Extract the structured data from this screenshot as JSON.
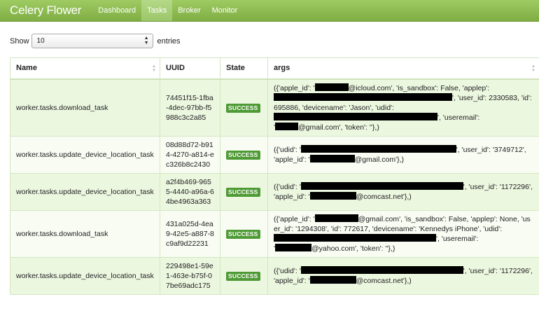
{
  "navbar": {
    "brand": "Celery Flower",
    "items": [
      {
        "label": "Dashboard",
        "active": false
      },
      {
        "label": "Tasks",
        "active": true
      },
      {
        "label": "Broker",
        "active": false
      },
      {
        "label": "Monitor",
        "active": false
      }
    ],
    "accent": "#8cba52"
  },
  "toolbar": {
    "show_label": "Show",
    "page_size": "10",
    "entries_label": "entries"
  },
  "table": {
    "columns": [
      "Name",
      "UUID",
      "State",
      "args"
    ],
    "rows": [
      {
        "name": "worker.tasks.download_task",
        "uuid": "74451f15-1fba-4dec-97bb-f5988c3c2a85",
        "state": "SUCCESS",
        "args": {
          "t1": "({'apple_id': '",
          "t2": "@icloud.com', 'is_sandbox': False, 'applep':",
          "t3": "', 'user_id': 2330583, 'id': 695886, 'devicename': 'Jason', 'udid':",
          "t4": "', 'useremail':",
          "t5": "'",
          "t6": "@gmail.com', 'token': ''},)"
        }
      },
      {
        "name": "worker.tasks.update_device_location_task",
        "uuid": "08d88d72-b914-4270-a814-ec326b8c2430",
        "state": "SUCCESS",
        "args": {
          "t1": "({'udid': '",
          "t2": "', 'user_id': '3749712', 'apple_id': '",
          "t3": "@gmail.com'},)"
        }
      },
      {
        "name": "worker.tasks.update_device_location_task",
        "uuid": "a2f4b469-9655-4440-a96a-64be4963a363",
        "state": "SUCCESS",
        "args": {
          "t1": "({'udid': '",
          "t2": "', 'user_id': '1172296', 'apple_id': '",
          "t3": "@comcast.net'},)"
        }
      },
      {
        "name": "worker.tasks.download_task",
        "uuid": "431a025d-4ea9-42e5-a887-8c9af9d22231",
        "state": "SUCCESS",
        "args": {
          "t1": "({'apple_id': '",
          "t2": "@gmail.com', 'is_sandbox': False, 'applep': None, 'user_id': '1294308', 'id': 772617, 'devicename': 'Kennedys iPhone', 'udid':",
          "t3": "', 'useremail':",
          "t4": "'",
          "t5": "@yahoo.com', 'token': ''},)"
        }
      },
      {
        "name": "worker.tasks.update_device_location_task",
        "uuid": "229498e1-59e1-463e-b75f-07be69adc175",
        "state": "SUCCESS",
        "args": {
          "t1": "({'udid': '",
          "t2": "', 'user_id': '1172296', 'apple_id': '",
          "t3": "@comcast.net'},)"
        }
      }
    ]
  },
  "colors": {
    "success_badge": "#4e9a34",
    "uuid_text": "#6d9a2e",
    "row_odd": "#ecf7e0",
    "row_even": "#f8fcf3"
  }
}
